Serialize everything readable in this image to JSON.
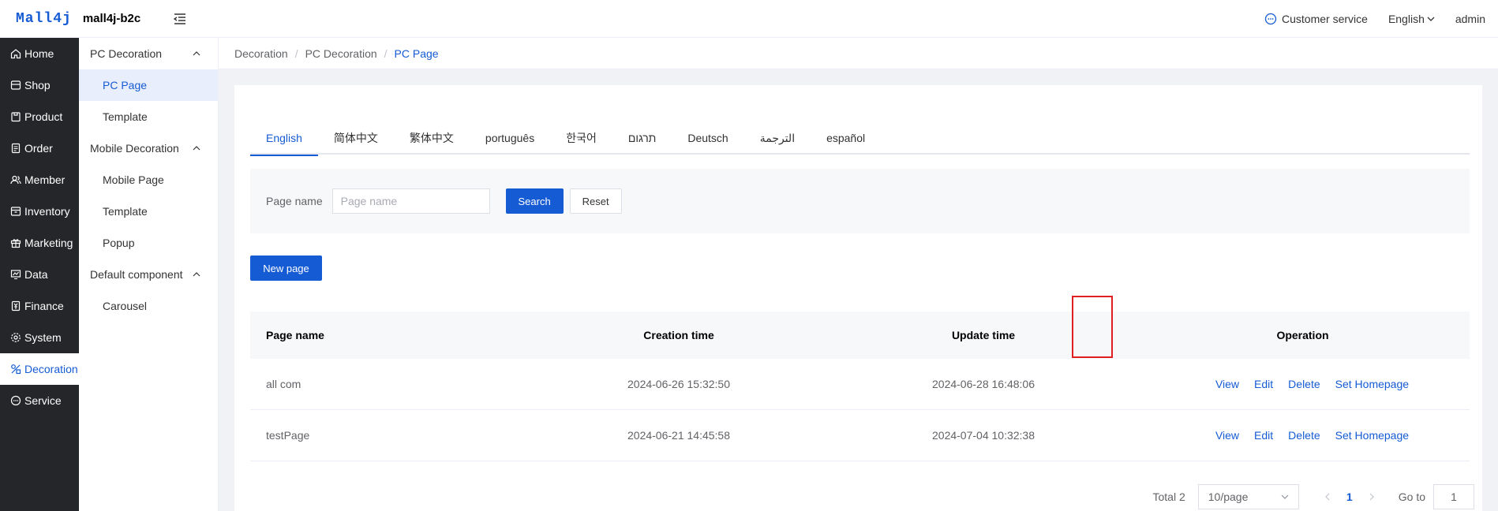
{
  "header": {
    "logo_mark": "Mall4j",
    "app_name": "mall4j-b2c",
    "customer_service": "Customer service",
    "language": "English",
    "user": "admin"
  },
  "nav": {
    "items": [
      {
        "label": "Home",
        "icon": "home-icon"
      },
      {
        "label": "Shop",
        "icon": "shop-icon"
      },
      {
        "label": "Product",
        "icon": "product-icon"
      },
      {
        "label": "Order",
        "icon": "order-icon"
      },
      {
        "label": "Member",
        "icon": "member-icon"
      },
      {
        "label": "Inventory",
        "icon": "inventory-icon"
      },
      {
        "label": "Marketing",
        "icon": "marketing-icon"
      },
      {
        "label": "Data",
        "icon": "data-icon"
      },
      {
        "label": "Finance",
        "icon": "finance-icon"
      },
      {
        "label": "System",
        "icon": "system-icon"
      },
      {
        "label": "Decoration",
        "icon": "decoration-icon"
      },
      {
        "label": "Service",
        "icon": "service-icon"
      }
    ],
    "active": "Decoration"
  },
  "subnav": {
    "groups": [
      {
        "label": "PC Decoration",
        "items": [
          "PC Page",
          "Template"
        ]
      },
      {
        "label": "Mobile Decoration",
        "items": [
          "Mobile Page",
          "Template",
          "Popup"
        ]
      },
      {
        "label": "Default component",
        "items": [
          "Carousel"
        ]
      }
    ],
    "active": "PC Page"
  },
  "breadcrumb": [
    "Decoration",
    "PC Decoration",
    "PC Page"
  ],
  "tabs": [
    "English",
    "简体中文",
    "繁体中文",
    "português",
    "한국어",
    "תרגום",
    "Deutsch",
    "الترجمة",
    "español"
  ],
  "search": {
    "label": "Page name",
    "placeholder": "Page name",
    "search_button": "Search",
    "reset_button": "Reset"
  },
  "new_page_button": "New page",
  "table": {
    "headers": [
      "Page name",
      "Creation time",
      "Update time",
      "Operation"
    ],
    "rows": [
      {
        "name": "all com",
        "created": "2024-06-26 15:32:50",
        "updated": "2024-06-28 16:48:06"
      },
      {
        "name": "testPage",
        "created": "2024-06-21 14:45:58",
        "updated": "2024-07-04 10:32:38"
      }
    ],
    "operations": [
      "View",
      "Edit",
      "Delete",
      "Set Homepage"
    ]
  },
  "pagination": {
    "total": "Total 2",
    "page_size": "10/page",
    "current_page": "1",
    "goto_label": "Go to",
    "goto_value": "1"
  },
  "colors": {
    "primary": "#155bd4",
    "sidebar_bg": "#242629",
    "highlight": "#e02020"
  }
}
